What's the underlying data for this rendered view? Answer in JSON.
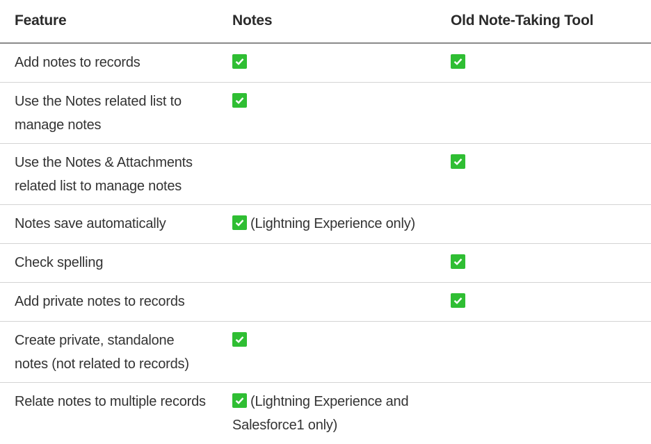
{
  "headers": {
    "feature": "Feature",
    "notes": "Notes",
    "old_tool": "Old Note-Taking Tool"
  },
  "rows": [
    {
      "feature_lines": [
        "Add notes to records"
      ],
      "notes_check": true,
      "notes_text": "",
      "notes_text_2": "",
      "old_check": true
    },
    {
      "feature_lines": [
        "Use the Notes related list to",
        "manage notes"
      ],
      "notes_check": true,
      "notes_text": "",
      "notes_text_2": "",
      "old_check": false
    },
    {
      "feature_lines": [
        "Use the Notes & Attachments",
        "related list to manage notes"
      ],
      "notes_check": false,
      "notes_text": "",
      "notes_text_2": "",
      "old_check": true
    },
    {
      "feature_lines": [
        "Notes save automatically"
      ],
      "notes_check": true,
      "notes_text": "(Lightning Experience only)",
      "notes_text_2": "",
      "old_check": false
    },
    {
      "feature_lines": [
        "Check spelling"
      ],
      "notes_check": false,
      "notes_text": "",
      "notes_text_2": "",
      "old_check": true
    },
    {
      "feature_lines": [
        "Add private notes to records"
      ],
      "notes_check": false,
      "notes_text": "",
      "notes_text_2": "",
      "old_check": true
    },
    {
      "feature_lines": [
        "Create private, standalone",
        "notes (not related to records)"
      ],
      "notes_check": true,
      "notes_text": "",
      "notes_text_2": "",
      "old_check": false
    },
    {
      "feature_lines": [
        "Relate notes to multiple records"
      ],
      "notes_check": true,
      "notes_text": "(Lightning Experience and",
      "notes_text_2": "Salesforce1 only)",
      "old_check": false
    }
  ],
  "colors": {
    "check_green": "#2fbe33",
    "text": "#333333",
    "rule": "#d4d4d4"
  },
  "icons": {
    "check": "checkmark-icon"
  }
}
